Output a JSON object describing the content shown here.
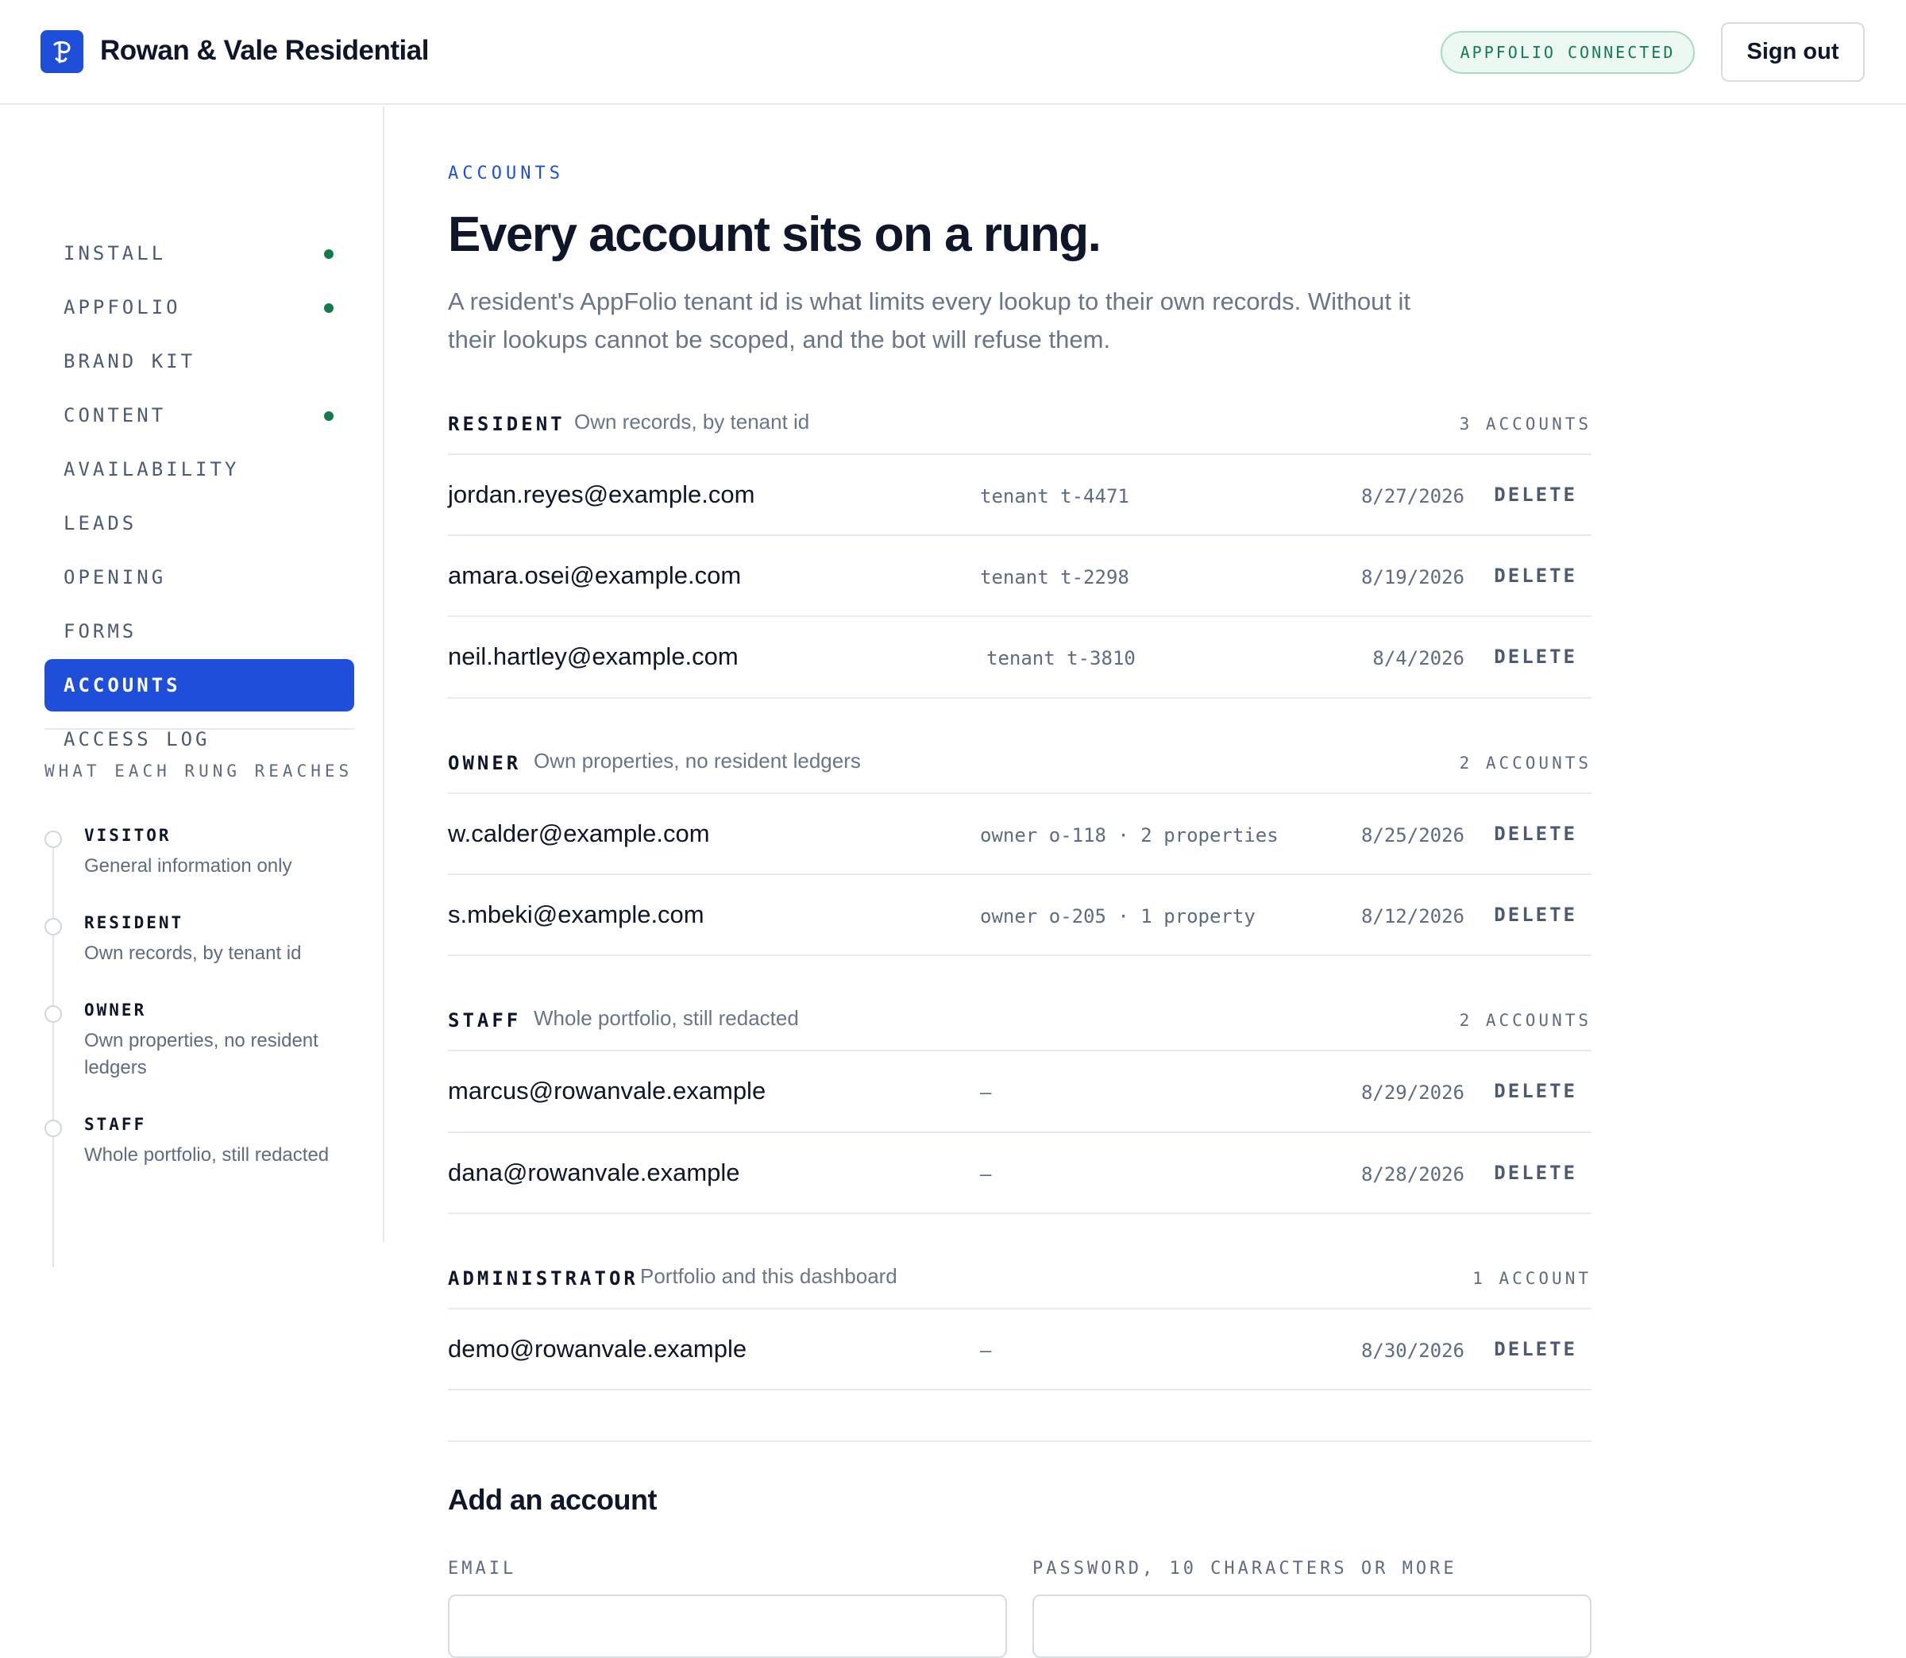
{
  "header": {
    "brand_name": "Rowan & Vale Residential",
    "connection_status": "APPFOLIO CONNECTED",
    "sign_out_label": "Sign out"
  },
  "sidebar": {
    "nav": [
      {
        "label": "INSTALL",
        "done": true
      },
      {
        "label": "APPFOLIO",
        "done": true
      },
      {
        "label": "BRAND KIT",
        "done": false
      },
      {
        "label": "CONTENT",
        "done": true
      },
      {
        "label": "AVAILABILITY",
        "done": false
      },
      {
        "label": "LEADS",
        "done": false
      },
      {
        "label": "OPENING",
        "done": false
      },
      {
        "label": "FORMS",
        "done": false
      },
      {
        "label": "ACCOUNTS",
        "done": false,
        "active": true
      },
      {
        "label": "ACCESS LOG",
        "done": false
      }
    ],
    "rungs_heading": "WHAT EACH RUNG REACHES",
    "rungs": [
      {
        "name": "VISITOR",
        "desc": "General information only"
      },
      {
        "name": "RESIDENT",
        "desc": "Own records, by tenant id"
      },
      {
        "name": "OWNER",
        "desc": "Own properties, no resident ledgers"
      },
      {
        "name": "STAFF",
        "desc": "Whole portfolio, still redacted"
      }
    ]
  },
  "main": {
    "eyebrow": "ACCOUNTS",
    "title": "Every account sits on a rung.",
    "intro": "A resident's AppFolio tenant id is what limits every lookup to their own records. Without it their lookups cannot be scoped, and the bot will refuse them.",
    "delete_label": "DELETE",
    "groups": [
      {
        "name": "RESIDENT",
        "desc": "Own records, by tenant id",
        "count": "3 ACCOUNTS",
        "accounts": [
          {
            "email": "jordan.reyes@example.com",
            "meta": "tenant t-4471",
            "date": "8/27/2026"
          },
          {
            "email": "amara.osei@example.com",
            "meta": "tenant t-2298",
            "date": "8/19/2026"
          },
          {
            "email": "neil.hartley@example.com",
            "meta": "tenant t-3810",
            "date": "8/4/2026"
          }
        ]
      },
      {
        "name": "OWNER",
        "desc": "Own properties, no resident ledgers",
        "count": "2 ACCOUNTS",
        "accounts": [
          {
            "email": "w.calder@example.com",
            "meta": "owner o-118 · 2 properties",
            "date": "8/25/2026"
          },
          {
            "email": "s.mbeki@example.com",
            "meta": "owner o-205 · 1 property",
            "date": "8/12/2026"
          }
        ]
      },
      {
        "name": "STAFF",
        "desc": "Whole portfolio, still redacted",
        "count": "2 ACCOUNTS",
        "accounts": [
          {
            "email": "marcus@rowanvale.example",
            "meta": "—",
            "date": "8/29/2026"
          },
          {
            "email": "dana@rowanvale.example",
            "meta": "—",
            "date": "8/28/2026"
          }
        ]
      },
      {
        "name": "ADMINISTRATOR",
        "desc": "Portfolio and this dashboard",
        "count": "1 ACCOUNT",
        "accounts": [
          {
            "email": "demo@rowanvale.example",
            "meta": "—",
            "date": "8/30/2026"
          }
        ]
      }
    ],
    "add_form": {
      "title": "Add an account",
      "email_label": "EMAIL",
      "email_value": "",
      "password_label": "PASSWORD, 10 CHARACTERS OR MORE",
      "password_value": ""
    }
  }
}
